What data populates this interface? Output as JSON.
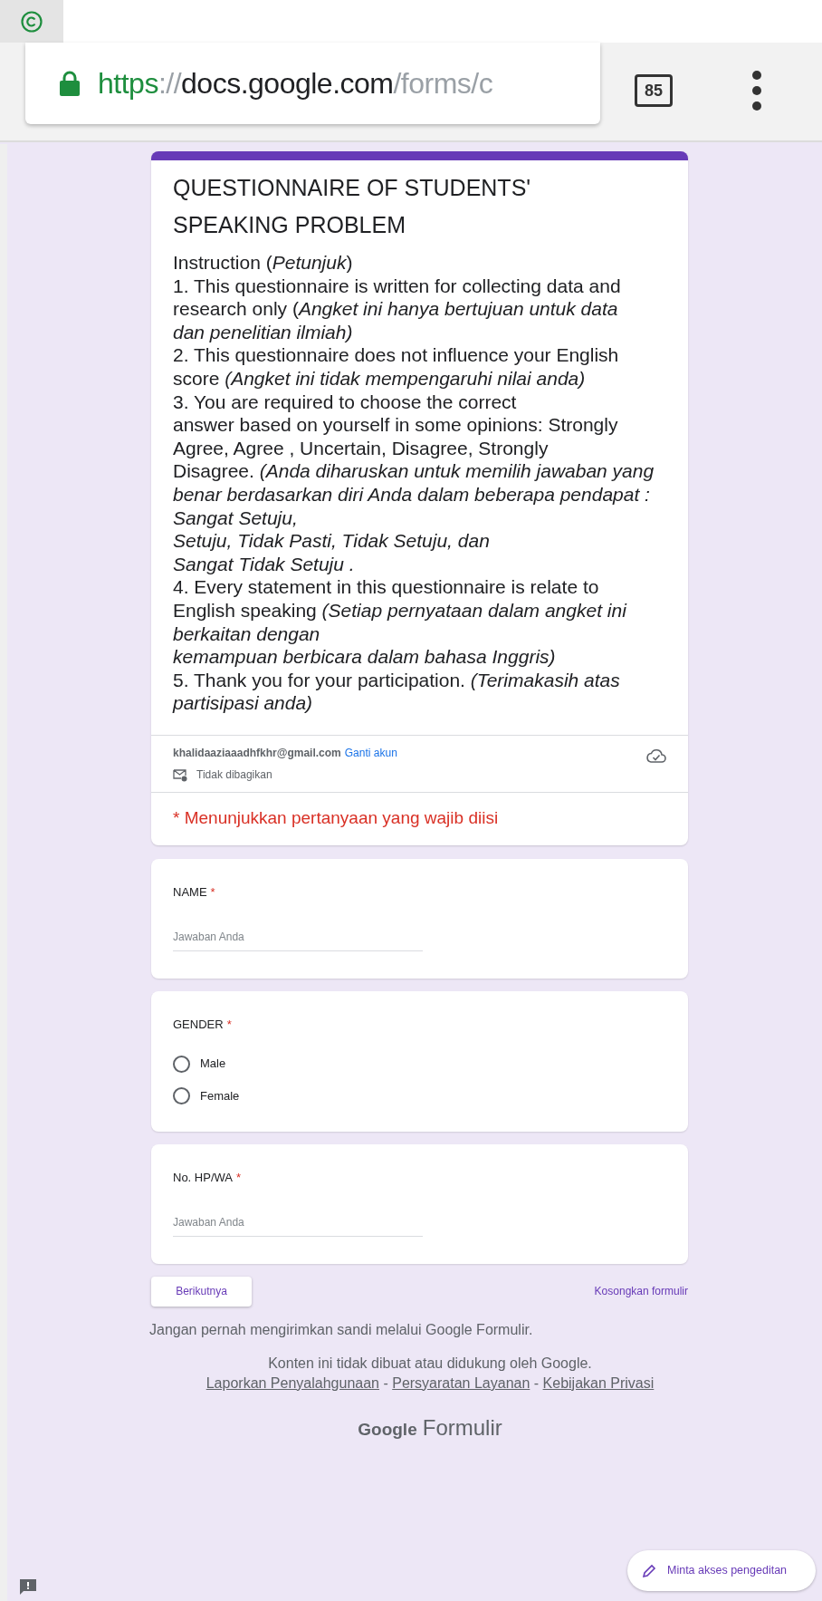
{
  "browser": {
    "url_scheme": "https",
    "url_separator": "://",
    "url_host": "docs.google.com",
    "url_path": "/forms/c",
    "tab_count": "85"
  },
  "form": {
    "title_lines": [
      "QUESTIONNAIRE OF STUDENTS'",
      "SPEAKING PROBLEM"
    ],
    "description_lines": [
      "Instruction (*Petunjuk*)",
      "1.  This questionnaire is written for collecting data and",
      "research only (*Angket ini hanya bertujuan untuk data*",
      "*dan penelitian ilmiah)*",
      "2. This questionnaire does not influence your English",
      "score *(Angket ini tidak mempengaruhi nilai anda)*",
      "3. You are required to choose the correct",
      "answer based on yourself in some opinions: Strongly",
      "Agree, Agree , Uncertain, Disagree, Strongly",
      "Disagree. *(Anda diharuskan untuk memilih jawaban yang*",
      "*benar berdasarkan diri Anda dalam beberapa pendapat :*",
      "*Sangat Setuju,*",
      "*Setuju, Tidak Pasti, Tidak Setuju, dan*",
      "*Sangat Tidak Setuju .*",
      "4. Every statement in this questionnaire is relate to",
      "English speaking *(Setiap pernyataan dalam angket ini*",
      "*berkaitan dengan*",
      "*kemampuan berbicara dalam bahasa Inggris)*",
      "5. Thank you for your participation. *(Terimakasih atas*",
      "*partisipasi anda)*"
    ],
    "account_email": "khalidaaziaaadhfkhr@gmail.com",
    "switch_account": "Ganti akun",
    "sharing": "Tidak dibagikan",
    "required_note": "* Menunjukkan pertanyaan yang wajib diisi"
  },
  "required_mark": "*",
  "questions": [
    {
      "kind": "text",
      "title": "NAME",
      "required": true,
      "placeholder": "Jawaban Anda"
    },
    {
      "kind": "radio",
      "title": "GENDER",
      "required": true,
      "options": [
        {
          "label": "Male",
          "selected": false
        },
        {
          "label": "Female",
          "selected": false
        }
      ]
    },
    {
      "kind": "text",
      "title": "No. HP/WA",
      "required": true,
      "placeholder": "Jawaban Anda"
    }
  ],
  "next_button": "Berikutnya",
  "clear_link": "Kosongkan formulir",
  "footer": {
    "warning": "Jangan pernah mengirimkan sandi melalui Google Formulir.",
    "disclaimer": "Konten ini tidak dibuat atau didukung oleh Google.",
    "links": [
      "Laporkan Penyalahgunaan",
      "Persyaratan Layanan",
      "Kebijakan Privasi"
    ],
    "separator": "-",
    "brand_google": "Google",
    "brand_product": "Formulir"
  },
  "edit_access_button": "Minta akses pengeditan"
}
